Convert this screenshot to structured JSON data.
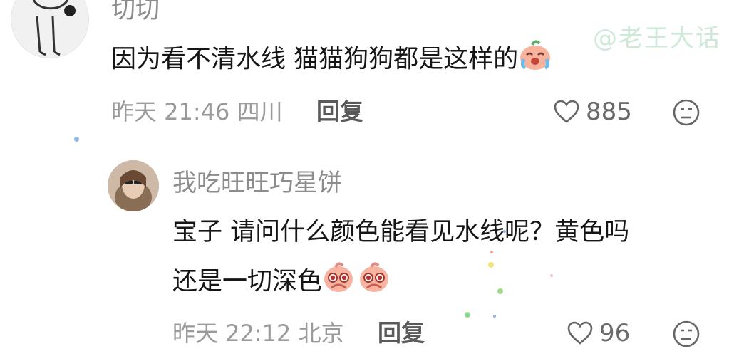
{
  "watermark": "@老王大话",
  "comment1": {
    "username": "切切",
    "text": "因为看不清水线 猫猫狗狗都是这样的",
    "time_location": "昨天 21:46 四川",
    "reply_label": "回复",
    "likes": "885",
    "emoji_icon": "crying-emoji-icon",
    "colors": {
      "emoji": "#f3a58c"
    }
  },
  "comment2": {
    "username": "我吃旺旺巧星饼",
    "text_line1": "宝子 请问什么颜色能看见水线呢？黄色吗",
    "text_line2": "还是一切深色",
    "time_location": "昨天 22:12 北京",
    "reply_label": "回复",
    "likes": "96",
    "emoji_icons": [
      "pleading-emoji-icon",
      "pleading-emoji-icon"
    ]
  }
}
